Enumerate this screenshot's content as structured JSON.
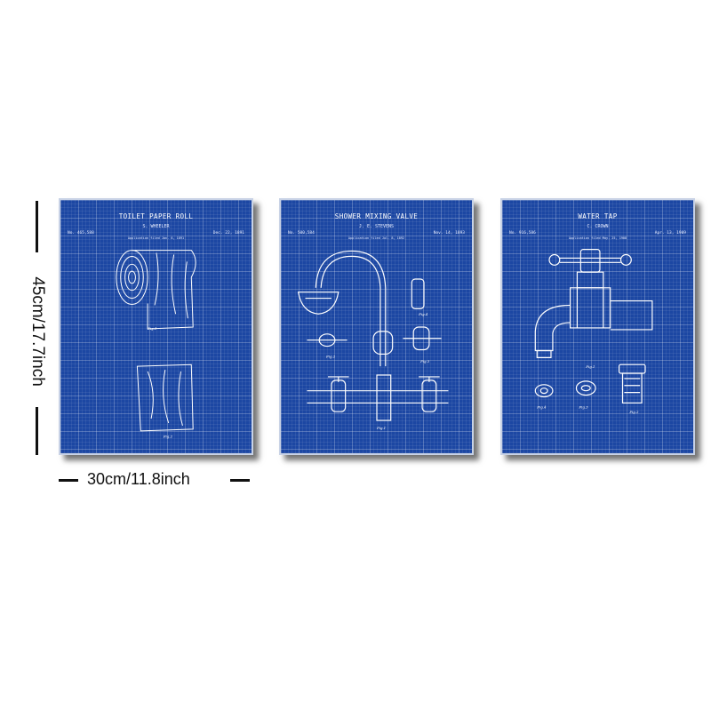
{
  "dimensions": {
    "height_label": "45cm/17.7inch",
    "width_label": "30cm/11.8inch"
  },
  "panels": [
    {
      "title": "TOILET PAPER ROLL",
      "inventor": "S. WHEELER",
      "patent_no": "No. 465,588",
      "filed": "Application filed Jan. 6, 1891",
      "date": "Dec. 22, 1891",
      "figures": [
        "Fig.1",
        "Fig.2"
      ]
    },
    {
      "title": "SHOWER MIXING VALVE",
      "inventor": "J. E. STEVENS",
      "patent_no": "No. 500,584",
      "filed": "Application filed Jul. 8, 1892",
      "date": "Nov. 14, 1893",
      "figures": [
        "Fig.1",
        "Fig.2",
        "Fig.3",
        "Fig.4"
      ]
    },
    {
      "title": "WATER TAP",
      "inventor": "C. CROWN",
      "patent_no": "No. 916,586",
      "filed": "Application filed May. 25, 1908",
      "date": "Apr. 13, 1909",
      "figures": [
        "Fig.1",
        "Fig.2",
        "Fig.3",
        "Fig.4"
      ]
    }
  ],
  "colors": {
    "blueprint": "#1c47a3",
    "linework": "#ffffff",
    "dimension": "#111111"
  }
}
